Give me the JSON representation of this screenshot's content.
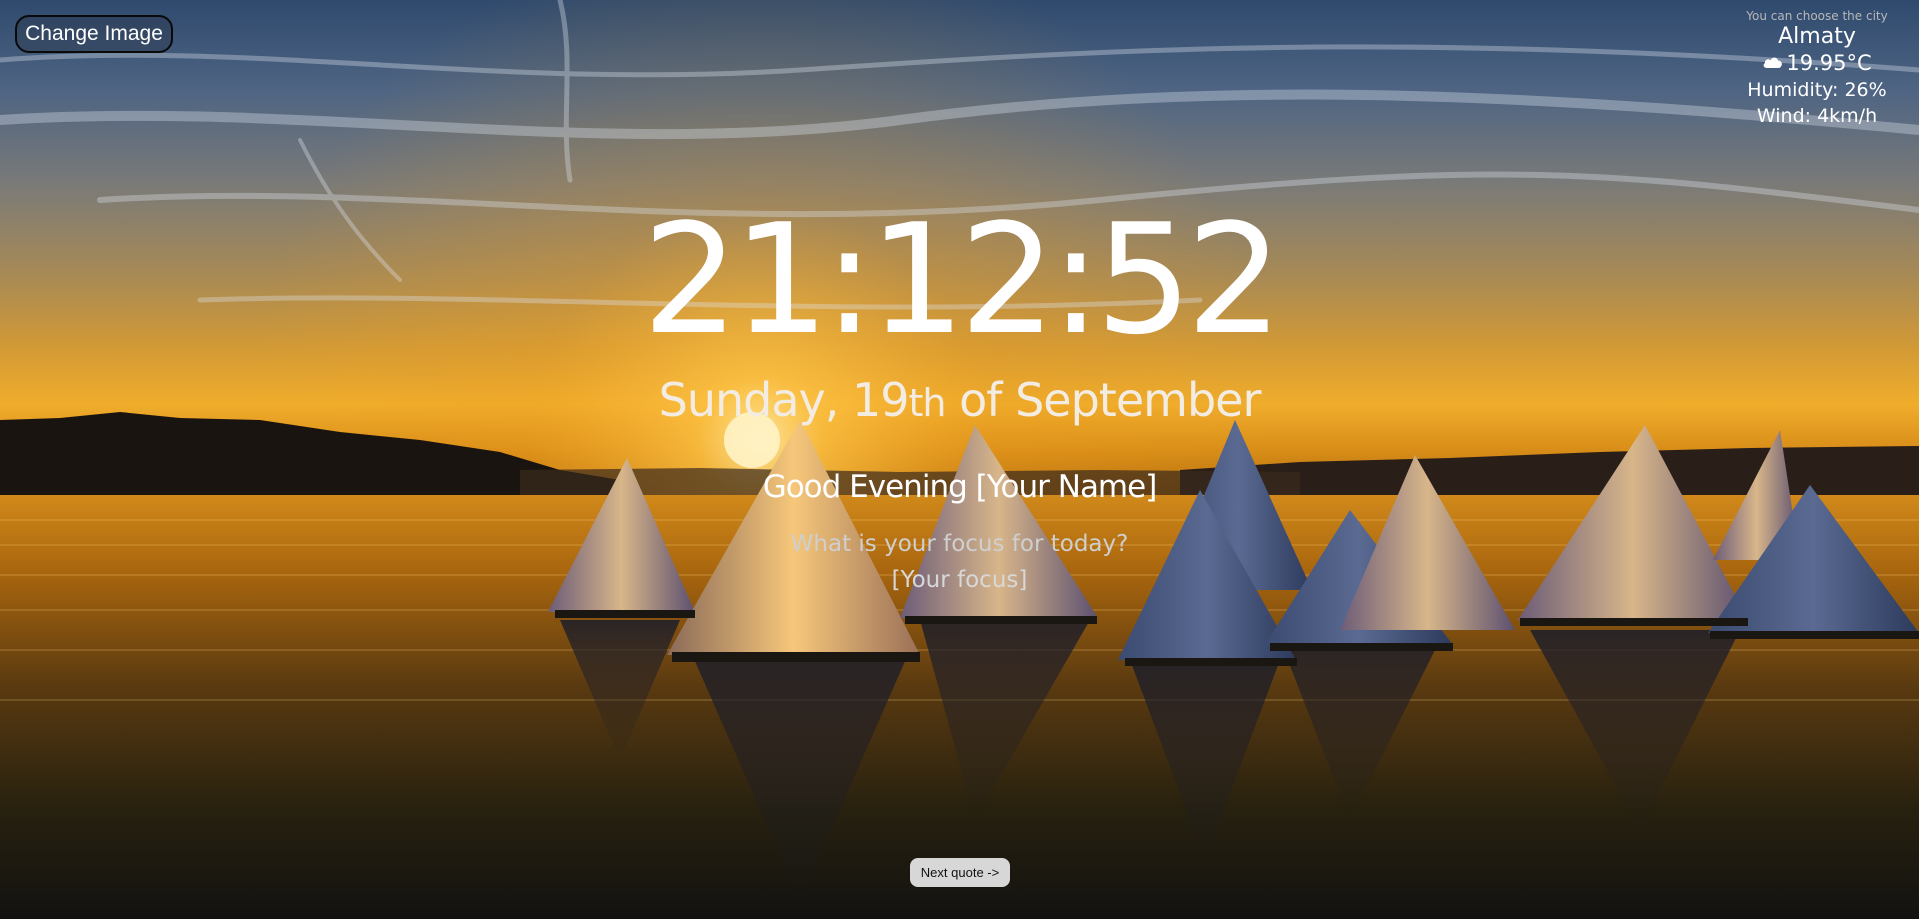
{
  "controls": {
    "change_image_label": "Change Image",
    "next_quote_label": "Next quote ->"
  },
  "weather": {
    "hint": "You can choose the city",
    "city": "Almaty",
    "icon": "cloud-icon",
    "temperature": "19.95°C",
    "humidity": "Humidity: 26%",
    "wind": "Wind: 4km/h"
  },
  "clock": {
    "time": "21:12:52"
  },
  "date": {
    "weekday_part": "Sunday, 19",
    "ordinal_suffix": "th",
    "month_part": " of September"
  },
  "greeting": {
    "prefix": "Good Evening ",
    "name": "[Your Name]"
  },
  "focus": {
    "question": "What is your focus for today?",
    "value": "[Your focus]"
  },
  "colors": {
    "text_primary": "#ffffff",
    "text_secondary": "#cfcfcf",
    "quote_button_bg": "#d7d7d7"
  }
}
